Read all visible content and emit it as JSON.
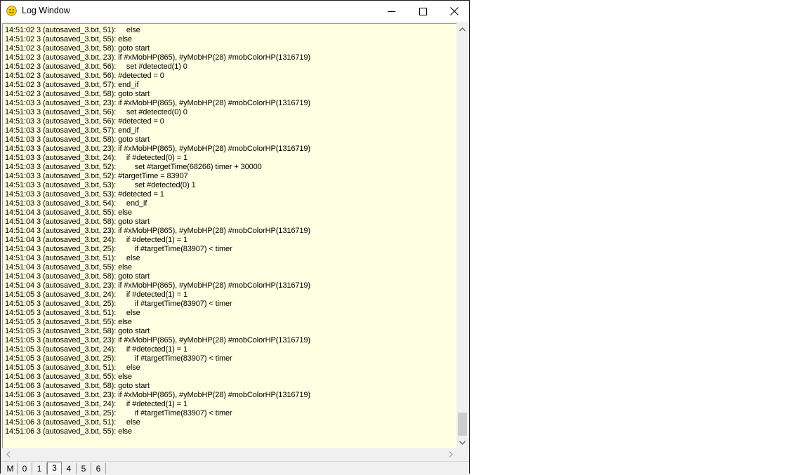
{
  "window": {
    "title": "Log Window",
    "title_icon": "smiley-face-icon"
  },
  "controls": {
    "minimize": "minimize-icon",
    "maximize": "maximize-icon",
    "close": "close-icon"
  },
  "log_lines": [
    "14:51:02 3 (autosaved_3.txt, 51):     else",
    "14:51:02 3 (autosaved_3.txt, 55): else",
    "14:51:02 3 (autosaved_3.txt, 58): goto start",
    "14:51:02 3 (autosaved_3.txt, 23): if #xMobHP(865), #yMobHP(28) #mobColorHP(1316719)",
    "14:51:02 3 (autosaved_3.txt, 56):     set #detected(1) 0",
    "14:51:02 3 (autosaved_3.txt, 56): #detected = 0",
    "14:51:02 3 (autosaved_3.txt, 57): end_if",
    "14:51:02 3 (autosaved_3.txt, 58): goto start",
    "14:51:03 3 (autosaved_3.txt, 23): if #xMobHP(865), #yMobHP(28) #mobColorHP(1316719)",
    "14:51:03 3 (autosaved_3.txt, 56):     set #detected(0) 0",
    "14:51:03 3 (autosaved_3.txt, 56): #detected = 0",
    "14:51:03 3 (autosaved_3.txt, 57): end_if",
    "14:51:03 3 (autosaved_3.txt, 58): goto start",
    "14:51:03 3 (autosaved_3.txt, 23): if #xMobHP(865), #yMobHP(28) #mobColorHP(1316719)",
    "14:51:03 3 (autosaved_3.txt, 24):     if #detected(0) = 1",
    "14:51:03 3 (autosaved_3.txt, 52):         set #targetTime(68266) timer + 30000",
    "14:51:03 3 (autosaved_3.txt, 52): #targetTime = 83907",
    "14:51:03 3 (autosaved_3.txt, 53):         set #detected(0) 1",
    "14:51:03 3 (autosaved_3.txt, 53): #detected = 1",
    "14:51:03 3 (autosaved_3.txt, 54):     end_if",
    "14:51:04 3 (autosaved_3.txt, 55): else",
    "14:51:04 3 (autosaved_3.txt, 58): goto start",
    "14:51:04 3 (autosaved_3.txt, 23): if #xMobHP(865), #yMobHP(28) #mobColorHP(1316719)",
    "14:51:04 3 (autosaved_3.txt, 24):     if #detected(1) = 1",
    "14:51:04 3 (autosaved_3.txt, 25):         if #targetTime(83907) < timer",
    "14:51:04 3 (autosaved_3.txt, 51):     else",
    "14:51:04 3 (autosaved_3.txt, 55): else",
    "14:51:04 3 (autosaved_3.txt, 58): goto start",
    "14:51:04 3 (autosaved_3.txt, 23): if #xMobHP(865), #yMobHP(28) #mobColorHP(1316719)",
    "14:51:05 3 (autosaved_3.txt, 24):     if #detected(1) = 1",
    "14:51:05 3 (autosaved_3.txt, 25):         if #targetTime(83907) < timer",
    "14:51:05 3 (autosaved_3.txt, 51):     else",
    "14:51:05 3 (autosaved_3.txt, 55): else",
    "14:51:05 3 (autosaved_3.txt, 58): goto start",
    "14:51:05 3 (autosaved_3.txt, 23): if #xMobHP(865), #yMobHP(28) #mobColorHP(1316719)",
    "14:51:05 3 (autosaved_3.txt, 24):     if #detected(1) = 1",
    "14:51:05 3 (autosaved_3.txt, 25):         if #targetTime(83907) < timer",
    "14:51:05 3 (autosaved_3.txt, 51):     else",
    "14:51:06 3 (autosaved_3.txt, 55): else",
    "14:51:06 3 (autosaved_3.txt, 58): goto start",
    "14:51:06 3 (autosaved_3.txt, 23): if #xMobHP(865), #yMobHP(28) #mobColorHP(1316719)",
    "14:51:06 3 (autosaved_3.txt, 24):     if #detected(1) = 1",
    "14:51:06 3 (autosaved_3.txt, 25):         if #targetTime(83907) < timer",
    "14:51:06 3 (autosaved_3.txt, 51):     else",
    "14:51:06 3 (autosaved_3.txt, 55): else"
  ],
  "tabs": [
    "M",
    "0",
    "1",
    "3",
    "4",
    "5",
    "6"
  ],
  "active_tab": "3",
  "colors": {
    "log_background": "#ffffe1",
    "scroll_thumb": "#cdcdcd"
  }
}
